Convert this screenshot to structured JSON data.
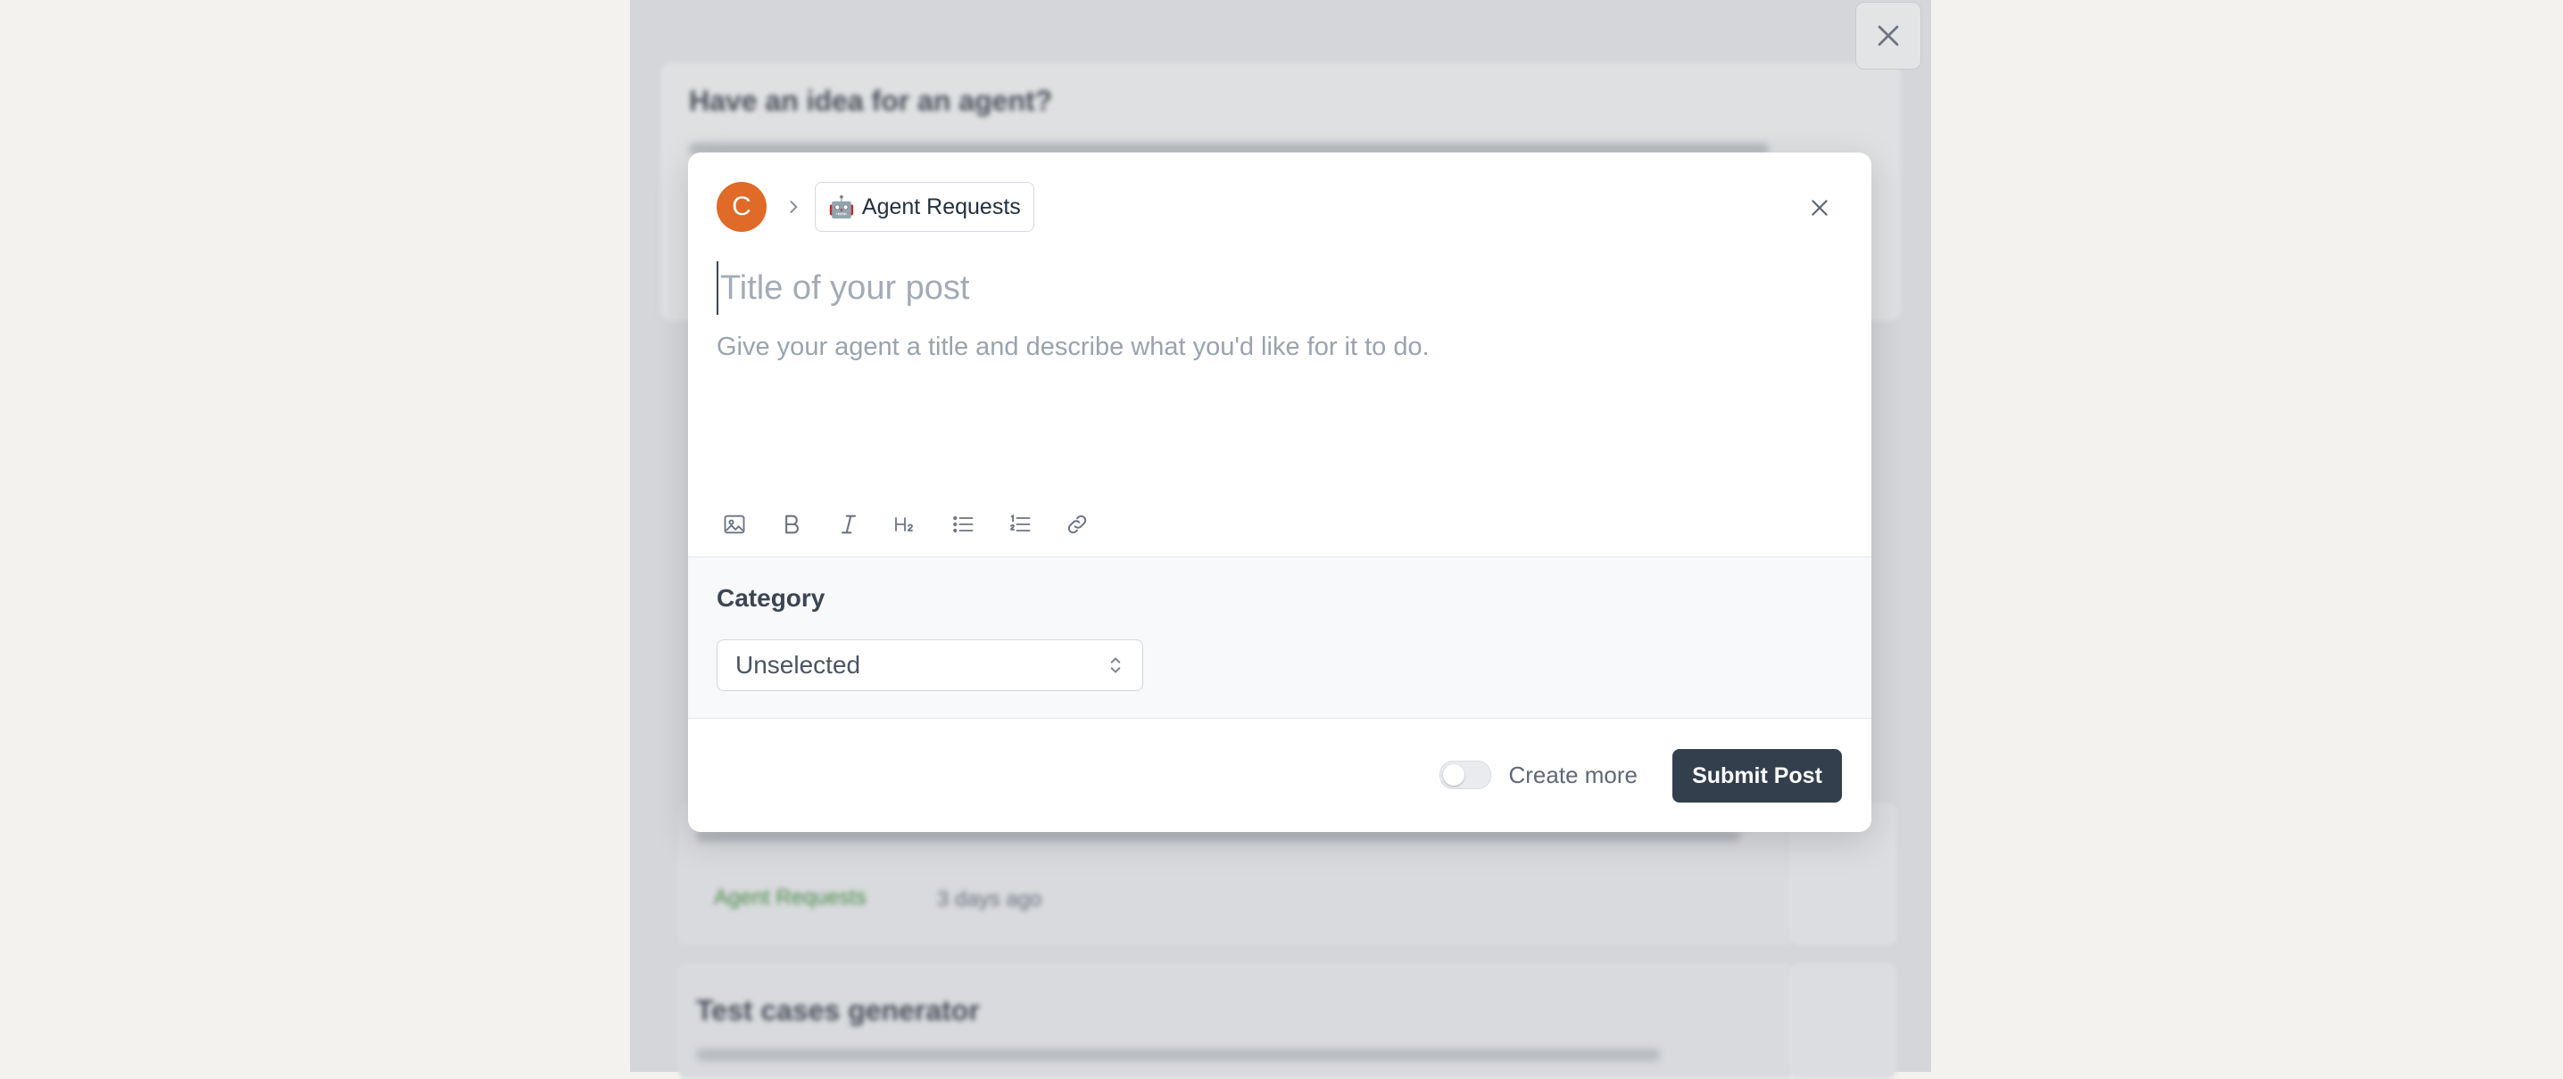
{
  "background": {
    "card_heading": "Have an idea for an agent?",
    "item_tag": "Agent Requests",
    "item_time": "3 days ago",
    "item2_title": "Test cases generator"
  },
  "modal": {
    "avatar_initial": "C",
    "board_name": "Agent Requests",
    "board_emoji": "🤖",
    "title_placeholder": "Title of your post",
    "description_placeholder": "Give your agent a title and describe what you'd like for it to do.",
    "toolbar": [
      "image-icon",
      "bold-icon",
      "italic-icon",
      "heading-2-icon",
      "bullet-list-icon",
      "numbered-list-icon",
      "link-icon"
    ],
    "category_label": "Category",
    "category_value": "Unselected",
    "create_more_label": "Create more",
    "create_more_on": false,
    "submit_label": "Submit Post"
  },
  "colors": {
    "avatar": "#e06a27",
    "submit_bg": "#333f4d",
    "placeholder": "#a3abb6"
  }
}
